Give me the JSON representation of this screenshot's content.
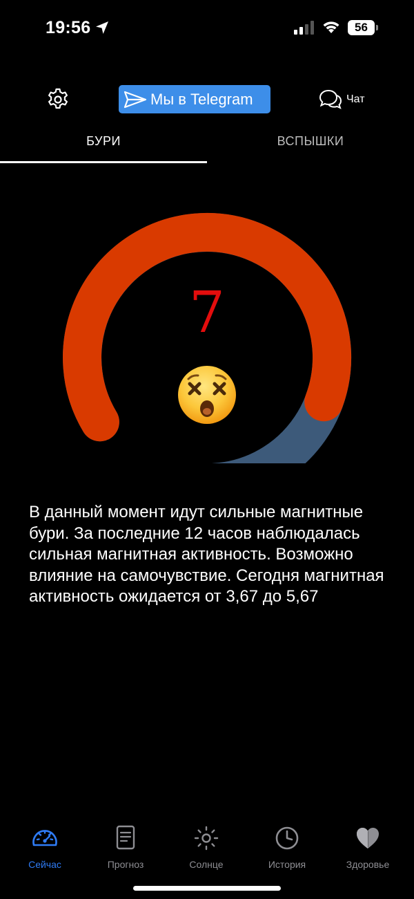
{
  "status_bar": {
    "time": "19:56",
    "battery": "56"
  },
  "header": {
    "telegram_label": "Мы в Telegram",
    "chat_label": "Чат",
    "telegram_color": "#3d8ee9"
  },
  "tabs": [
    {
      "label": "БУРИ",
      "active": true
    },
    {
      "label": "ВСПЫШКИ",
      "active": false
    }
  ],
  "gauge": {
    "value": "7",
    "level": 7,
    "max": 9,
    "fill_color": "#d93a00",
    "track_color": "#3d5a7a",
    "value_color": "#e30d0d",
    "emoji": "dizzy-face-icon"
  },
  "description": "В данный момент идут сильные магнитные бури. За последние 12 часов наблюдалась сильная магнитная активность. Возможно влияние на самочувствие. Сегодня магнитная активность ожидается от 3,67 до 5,67",
  "bottom_nav": [
    {
      "label": "Сейчас",
      "icon": "speedometer-icon",
      "active": true
    },
    {
      "label": "Прогноз",
      "icon": "document-icon",
      "active": false
    },
    {
      "label": "Солнце",
      "icon": "sun-icon",
      "active": false
    },
    {
      "label": "История",
      "icon": "clock-icon",
      "active": false
    },
    {
      "label": "Здоровье",
      "icon": "heart-icon",
      "active": false
    }
  ],
  "colors": {
    "accent": "#2f7cf6",
    "inactive": "#8e8e93",
    "background": "#000000"
  }
}
